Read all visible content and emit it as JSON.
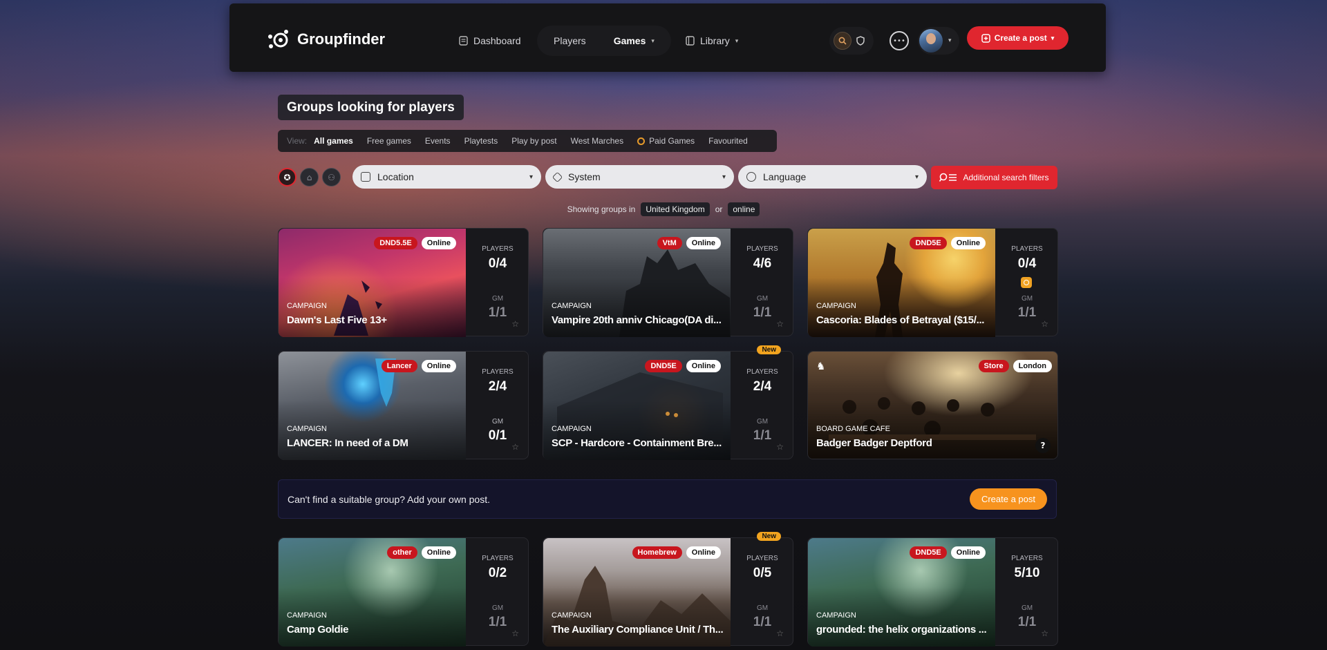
{
  "header": {
    "logo_text": "Groupfinder",
    "nav": {
      "dashboard": "Dashboard",
      "players": "Players",
      "games": "Games",
      "library": "Library"
    },
    "create_post": "Create a post"
  },
  "page_title": "Groups looking for players",
  "view_bar": {
    "label": "View:",
    "items": [
      "All games",
      "Free games",
      "Events",
      "Playtests",
      "Play by post",
      "West Marches",
      "Paid Games",
      "Favourited"
    ]
  },
  "filters": {
    "location": "Location",
    "system": "System",
    "language": "Language",
    "additional": "Additional search filters"
  },
  "showing": {
    "prefix": "Showing groups in",
    "country": "United Kingdom",
    "or": "or",
    "online": "online"
  },
  "cards": [
    {
      "system": "DND5.5E",
      "loc": "Online",
      "type": "CAMPAIGN",
      "title": "Dawn's Last Five 13+",
      "players_label": "PLAYERS",
      "players": "0/4",
      "gm_label": "GM",
      "gm": "1/1"
    },
    {
      "system": "VtM",
      "loc": "Online",
      "type": "CAMPAIGN",
      "title": "Vampire 20th anniv Chicago(DA di...",
      "players_label": "PLAYERS",
      "players": "4/6",
      "gm_label": "GM",
      "gm": "1/1"
    },
    {
      "system": "DND5E",
      "loc": "Online",
      "type": "CAMPAIGN",
      "title": "Cascoria: Blades of Betrayal ($15/...",
      "players_label": "PLAYERS",
      "players": "0/4",
      "gm_label": "GM",
      "gm": "1/1"
    },
    {
      "system": "Lancer",
      "loc": "Online",
      "type": "CAMPAIGN",
      "title": "LANCER: In need of a DM",
      "players_label": "PLAYERS",
      "players": "2/4",
      "gm_label": "GM",
      "gm": "0/1"
    },
    {
      "system": "DND5E",
      "loc": "Online",
      "type": "CAMPAIGN",
      "title": "SCP - Hardcore - Containment Bre...",
      "players_label": "PLAYERS",
      "players": "2/4",
      "gm_label": "GM",
      "gm": "1/1",
      "new": "New"
    },
    {
      "system": "Store",
      "loc": "London",
      "type": "BOARD GAME CAFE",
      "title": "Badger Badger Deptford",
      "qmark": "?"
    },
    {
      "system": "other",
      "loc": "Online",
      "type": "CAMPAIGN",
      "title": "Camp Goldie",
      "players_label": "PLAYERS",
      "players": "0/2",
      "gm_label": "GM",
      "gm": "1/1"
    },
    {
      "system": "Homebrew",
      "loc": "Online",
      "type": "CAMPAIGN",
      "title": "The Auxiliary Compliance Unit / Th...",
      "players_label": "PLAYERS",
      "players": "0/5",
      "gm_label": "GM",
      "gm": "1/1",
      "new": "New"
    },
    {
      "system": "DND5E",
      "loc": "Online",
      "type": "CAMPAIGN",
      "title": "grounded: the helix organizations ...",
      "players_label": "PLAYERS",
      "players": "5/10",
      "gm_label": "GM",
      "gm": "1/1"
    }
  ],
  "cta": {
    "text": "Can't find a suitable group? Add your own post.",
    "button": "Create a post"
  },
  "colors": {
    "accent_red": "#e0262f",
    "accent_orange": "#f7931e",
    "new_badge": "#f2a41f"
  }
}
